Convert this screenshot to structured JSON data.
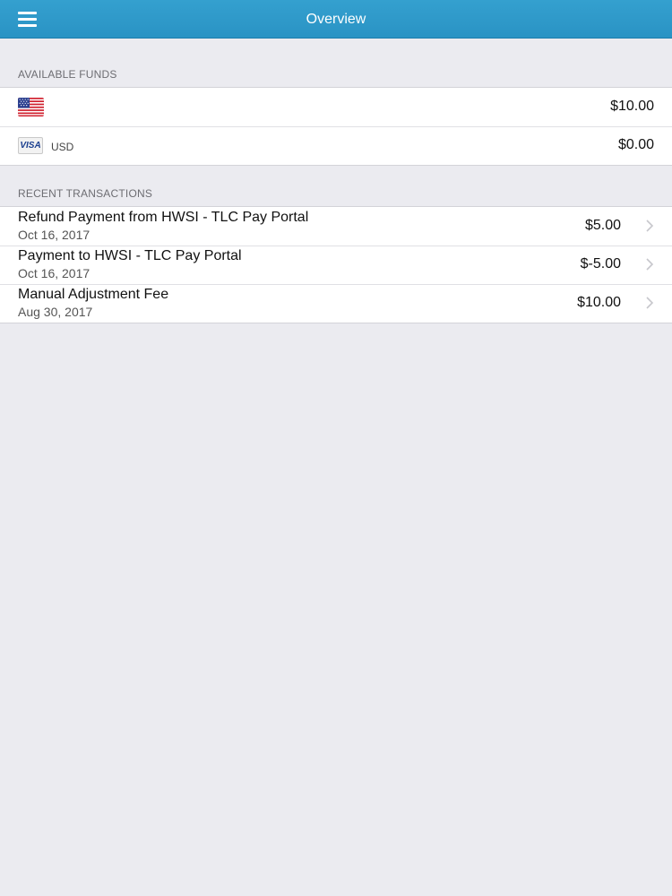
{
  "navbar": {
    "title": "Overview",
    "menu_icon": "hamburger-menu-icon"
  },
  "available_funds": {
    "header": "AVAILABLE FUNDS",
    "items": [
      {
        "icon": "us-flag-icon",
        "label": "",
        "amount": "$10.00"
      },
      {
        "icon": "visa-card-icon",
        "card_text": "VISA",
        "label": "USD",
        "amount": "$0.00"
      }
    ]
  },
  "recent_transactions": {
    "header": "RECENT TRANSACTIONS",
    "items": [
      {
        "title": "Refund Payment from HWSI - TLC Pay Portal",
        "date": "Oct 16, 2017",
        "amount": "$5.00"
      },
      {
        "title": "Payment to HWSI - TLC Pay Portal",
        "date": "Oct 16, 2017",
        "amount": "$-5.00"
      },
      {
        "title": "Manual Adjustment Fee",
        "date": "Aug 30, 2017",
        "amount": "$10.00"
      }
    ]
  },
  "colors": {
    "navbar": "#2f9ac9",
    "background": "#ebebf0",
    "row_background": "#ffffff",
    "section_text": "#6d6d72"
  }
}
